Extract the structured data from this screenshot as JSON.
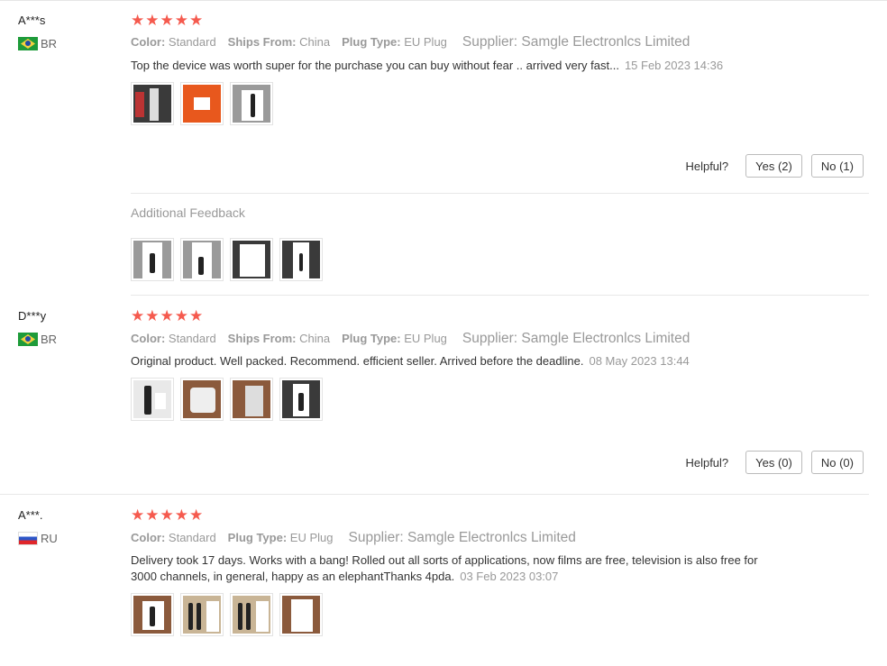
{
  "reviews": [
    {
      "user": "A***s",
      "country": "BR",
      "stars": "★★★★★",
      "attrs": [
        {
          "key": "Color:",
          "value": "Standard"
        },
        {
          "key": "Ships From:",
          "value": "China"
        },
        {
          "key": "Plug Type:",
          "value": "EU Plug"
        }
      ],
      "supplier": "Supplier: Samgle Electronlcs Limited",
      "text": "Top the device was worth super for the purchase you can buy without fear .. arrived very fast...",
      "date": "15 Feb 2023 14:36",
      "helpful_label": "Helpful?",
      "yes_label": "Yes (2)",
      "no_label": "No (1)",
      "additional_feedback_label": "Additional Feedback"
    },
    {
      "user": "D***y",
      "country": "BR",
      "stars": "★★★★★",
      "attrs": [
        {
          "key": "Color:",
          "value": "Standard"
        },
        {
          "key": "Ships From:",
          "value": "China"
        },
        {
          "key": "Plug Type:",
          "value": "EU Plug"
        }
      ],
      "supplier": "Supplier: Samgle Electronlcs Limited",
      "text": "Original product. Well packed. Recommend. efficient seller. Arrived before the deadline.",
      "date": "08 May 2023 13:44",
      "helpful_label": "Helpful?",
      "yes_label": "Yes (0)",
      "no_label": "No (0)"
    },
    {
      "user": "A***.",
      "country": "RU",
      "stars": "★★★★★",
      "attrs": [
        {
          "key": "Color:",
          "value": "Standard"
        },
        {
          "key": "Plug Type:",
          "value": "EU Plug"
        }
      ],
      "supplier": "Supplier: Samgle Electronlcs Limited",
      "text": "Delivery took 17 days. Works with a bang! Rolled out all sorts of applications, now films are free, television is also free for 3000 channels, in general, happy as an elephantThanks 4pda.",
      "date": "03 Feb 2023 03:07"
    }
  ],
  "colors": {
    "star": "#f55a4e",
    "muted": "#999999",
    "border": "#bbbbbb"
  },
  "icons": {
    "flag_br": "brazil-flag-icon",
    "flag_ru": "russia-flag-icon"
  }
}
